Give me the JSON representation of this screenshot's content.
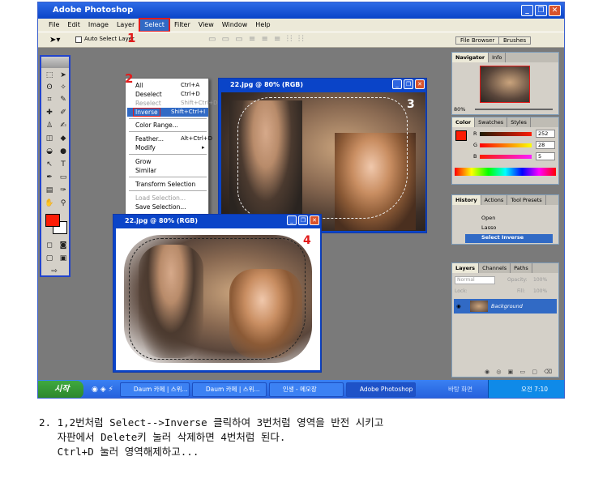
{
  "app": {
    "title": "Adobe Photoshop",
    "menus": [
      "File",
      "Edit",
      "Image",
      "Layer",
      "Select",
      "Filter",
      "View",
      "Window",
      "Help"
    ],
    "selected_menu": "Select"
  },
  "options_bar": {
    "auto_select_layer": "Auto Select Layer",
    "file_browser": "File Browser",
    "brushes": "Brushes"
  },
  "select_menu": {
    "items": [
      {
        "label": "All",
        "shortcut": "Ctrl+A",
        "disabled": false
      },
      {
        "label": "Deselect",
        "shortcut": "Ctrl+D",
        "disabled": false
      },
      {
        "label": "Reselect",
        "shortcut": "Shift+Ctrl+D",
        "disabled": true
      },
      {
        "label": "Inverse",
        "shortcut": "Shift+Ctrl+I",
        "disabled": false,
        "highlighted": true
      },
      {
        "label": "Color Range...",
        "shortcut": "",
        "disabled": false
      },
      {
        "label": "Feather...",
        "shortcut": "Alt+Ctrl+D",
        "disabled": false
      },
      {
        "label": "Modify",
        "shortcut": "▸",
        "disabled": false
      },
      {
        "label": "Grow",
        "shortcut": "",
        "disabled": false
      },
      {
        "label": "Similar",
        "shortcut": "",
        "disabled": false
      },
      {
        "label": "Transform Selection",
        "shortcut": "",
        "disabled": false
      },
      {
        "label": "Load Selection...",
        "shortcut": "",
        "disabled": true
      },
      {
        "label": "Save Selection...",
        "shortcut": "",
        "disabled": false
      }
    ]
  },
  "annotations": {
    "step1": "1",
    "step2": "2",
    "step3": "3",
    "step4": "4"
  },
  "documents": {
    "back": {
      "title": "22.jpg @ 80% (RGB)"
    },
    "front": {
      "title": "22.jpg @ 80% (RGB)"
    }
  },
  "navigator": {
    "tabs": [
      "Navigator",
      "Info"
    ],
    "zoom": "80%"
  },
  "color_panel": {
    "tabs": [
      "Color",
      "Swatches",
      "Styles"
    ],
    "r_label": "R",
    "r": "252",
    "g_label": "G",
    "g": "28",
    "b_label": "B",
    "b": "5"
  },
  "history_panel": {
    "tabs": [
      "History",
      "Actions",
      "Tool Presets"
    ],
    "items": [
      "Open",
      "Lasso",
      "Select Inverse"
    ]
  },
  "layers_panel": {
    "tabs": [
      "Layers",
      "Channels",
      "Paths"
    ],
    "blend": "Normal",
    "opacity_label": "Opacity:",
    "opacity": "100%",
    "lock_label": "Lock:",
    "fill_label": "Fill:",
    "fill": "100%",
    "layer_name": "Background"
  },
  "taskbar": {
    "start": "시작",
    "tasks": [
      "Daum 카페 | 스위...",
      "Daum 카페 | 스위...",
      "인생 - 메모장",
      "Adobe Photoshop"
    ],
    "tray_label": "바탕 화면",
    "clock": "오전 7:10"
  },
  "caption": {
    "line1": "2. 1,2번처럼 Select-->Inverse 클릭하여 3번처럼 영역을 반전 시키고",
    "line2": "   자판에서 Delete키 눌러 삭제하면 4번처럼 된다.",
    "line3": "   Ctrl+D 눌러 영역해제하고..."
  },
  "colors": {
    "foreground": "#fc1c05",
    "highlight": "#e21c1c",
    "titlebar": "#0a44c8"
  }
}
